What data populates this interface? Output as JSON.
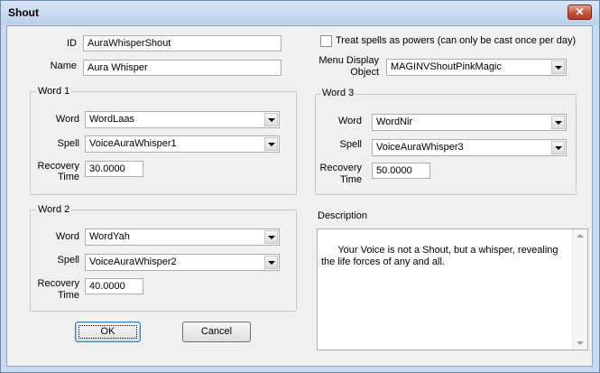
{
  "window": {
    "title": "Shout",
    "close_glyph": "✕"
  },
  "id_label": "ID",
  "id_value": "AuraWhisperShout",
  "name_label": "Name",
  "name_value": "Aura Whisper",
  "treat_spells": {
    "label": "Treat spells as powers (can only be cast once per day)",
    "checked": false
  },
  "menu_display": {
    "label_line1": "Menu Display",
    "label_line2": "Object",
    "value": "MAGINVShoutPinkMagic"
  },
  "word1": {
    "title": "Word 1",
    "word_label": "Word",
    "word_value": "WordLaas",
    "spell_label": "Spell",
    "spell_value": "VoiceAuraWhisper1",
    "recovery_label1": "Recovery",
    "recovery_label2": "Time",
    "recovery_value": "30.0000"
  },
  "word2": {
    "title": "Word 2",
    "word_label": "Word",
    "word_value": "WordYah",
    "spell_label": "Spell",
    "spell_value": "VoiceAuraWhisper2",
    "recovery_label1": "Recovery",
    "recovery_label2": "Time",
    "recovery_value": "40.0000"
  },
  "word3": {
    "title": "Word 3",
    "word_label": "Word",
    "word_value": "WordNir",
    "spell_label": "Spell",
    "spell_value": "VoiceAuraWhisper3",
    "recovery_label1": "Recovery",
    "recovery_label2": "Time",
    "recovery_value": "50.0000"
  },
  "description": {
    "label": "Description",
    "text": "Your Voice is not a Shout, but a whisper, revealing the life forces of any and all."
  },
  "buttons": {
    "ok": "OK",
    "cancel": "Cancel"
  }
}
